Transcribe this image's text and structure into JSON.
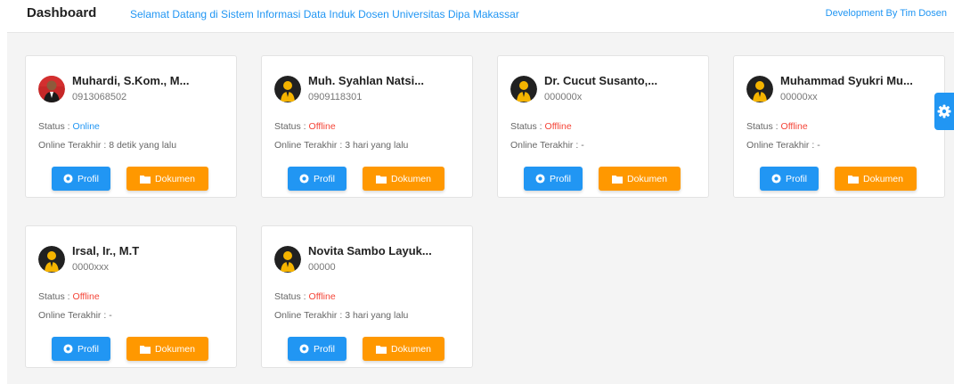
{
  "header": {
    "title": "Dashboard",
    "welcome": "Selamat Datang di Sistem Informasi Data Induk Dosen Universitas Dipa Makassar",
    "credit": "Development By Tim Dosen"
  },
  "labels": {
    "status_prefix": "Status : ",
    "last_online_prefix": "Online Terakhir : ",
    "profil_button": "Profil",
    "dokumen_button": "Dokumen"
  },
  "colors": {
    "primary": "#2196f3",
    "accent": "#ff9800",
    "offline": "#f44336",
    "online": "#2196f3"
  },
  "lecturers": [
    {
      "name": "Muhardi, S.Kom., M...",
      "nip": "0913068502",
      "status": "Online",
      "last_online": "8 detik yang lalu",
      "avatar": "photo-avatar"
    },
    {
      "name": "Muh. Syahlan Natsi...",
      "nip": "0909118301",
      "status": "Offline",
      "last_online": "3 hari yang lalu",
      "avatar": "default-avatar"
    },
    {
      "name": "Dr. Cucut Susanto,...",
      "nip": "000000x",
      "status": "Offline",
      "last_online": "-",
      "avatar": "default-avatar"
    },
    {
      "name": "Muhammad Syukri Mu...",
      "nip": "00000xx",
      "status": "Offline",
      "last_online": "-",
      "avatar": "default-avatar"
    },
    {
      "name": "Irsal, Ir., M.T",
      "nip": "0000xxx",
      "status": "Offline",
      "last_online": "-",
      "avatar": "default-avatar"
    },
    {
      "name": "Novita Sambo Layuk...",
      "nip": "00000",
      "status": "Offline",
      "last_online": "3 hari yang lalu",
      "avatar": "default-avatar"
    }
  ],
  "settings": {
    "icon": "gear-icon"
  }
}
